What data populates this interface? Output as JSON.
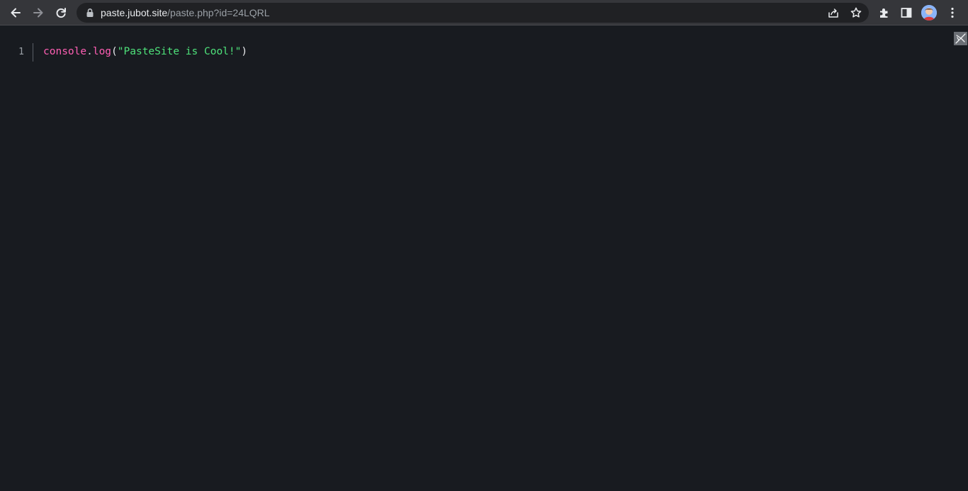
{
  "browser": {
    "url_host": "paste.jubot.site",
    "url_path": "/paste.php?id=24LQRL",
    "icons": [
      "back-icon",
      "forward-icon",
      "reload-icon",
      "lock-icon",
      "share-icon",
      "star-icon",
      "extensions-icon",
      "side-panel-icon",
      "profile-avatar",
      "menu-icon"
    ]
  },
  "editor": {
    "lines": [
      {
        "number": "1",
        "tokens": {
          "object": "console",
          "dot": ".",
          "method": "log",
          "open_paren": "(",
          "string": "\"PasteSite is Cool!\"",
          "close_paren": ")"
        }
      }
    ]
  },
  "colors": {
    "background": "#181b20",
    "keyword_pink": "#ff5fb4",
    "string_green": "#4ee27a",
    "toolbar": "#35363a",
    "omnibox": "#202124"
  }
}
